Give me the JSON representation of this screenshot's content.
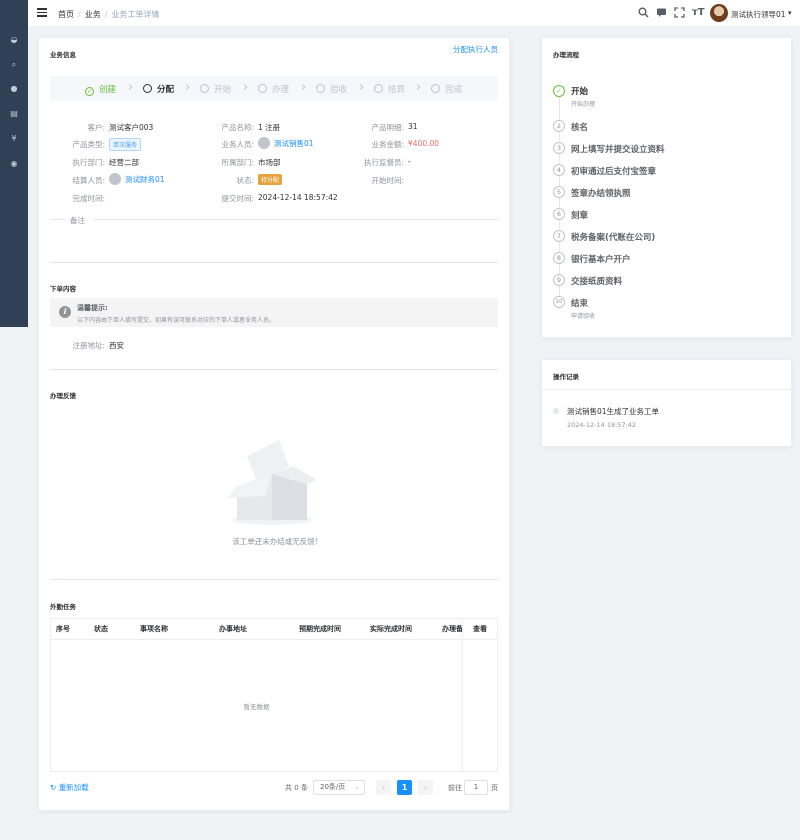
{
  "header": {
    "breadcrumb": [
      "首页",
      "业务",
      "业务工单详情"
    ],
    "user_name": "测试执行领导01"
  },
  "info": {
    "title": "业务信息",
    "assign_link": "分配执行人员",
    "steps": [
      "创建",
      "分配",
      "开始",
      "办理",
      "验收",
      "结算",
      "完成"
    ],
    "fields": {
      "customer_label": "客户:",
      "customer": "测试客户003",
      "product_name_label": "产品名称:",
      "product_name": "1 注册",
      "product_detail_label": "产品明细:",
      "product_detail": "31",
      "product_type_label": "产品类型:",
      "product_type": "单次服务",
      "salesperson_label": "业务人员:",
      "salesperson": "测试销售01",
      "amount_label": "业务金额:",
      "amount": "¥400.00",
      "exec_dept_label": "执行部门:",
      "exec_dept": "经营二部",
      "dept_label": "所属部门:",
      "dept": "市场部",
      "supervisor_label": "执行监督员:",
      "supervisor": "-",
      "settler_label": "结算人员:",
      "settler": "测试财务01",
      "status_label": "状态:",
      "status": "待分配",
      "start_time_label": "开始时间:",
      "start_time": "",
      "finish_time_label": "完成时间:",
      "finish_time": "",
      "submit_time_label": "提交时间:",
      "submit_time": "2024-12-14 18:57:42"
    },
    "remark_label": "备注"
  },
  "order": {
    "title": "下单内容",
    "tip_title": "温馨提示:",
    "tip_text": "以下内容由下单人填写提交，如果有误可联系对应的下单人或者业务人员。",
    "address_label": "注册地址:",
    "address": "西安"
  },
  "feedback": {
    "title": "办理反馈",
    "empty_text": "该工单还未办结或无反馈!"
  },
  "tasks": {
    "title": "外勤任务",
    "columns": [
      "序号",
      "状态",
      "事项名称",
      "办事地址",
      "预期完成时间",
      "实际完成时间",
      "办理备",
      "查看"
    ],
    "empty_text": "暂无数据",
    "reload": "重新加载",
    "total": "共 0 条",
    "page_size": "20条/页",
    "current_page": "1",
    "goto_label": "前往",
    "goto_value": "1",
    "page_unit": "页"
  },
  "flow": {
    "title": "办理流程",
    "items": [
      {
        "num": "✓",
        "title": "开始",
        "sub": "开始办理"
      },
      {
        "num": "2",
        "title": "核名",
        "sub": ""
      },
      {
        "num": "3",
        "title": "网上填写并提交设立资料",
        "sub": ""
      },
      {
        "num": "4",
        "title": "初审通过后支付宝签章",
        "sub": ""
      },
      {
        "num": "5",
        "title": "签章办结领执照",
        "sub": ""
      },
      {
        "num": "6",
        "title": "刻章",
        "sub": ""
      },
      {
        "num": "7",
        "title": "税务备案(代账在公司)",
        "sub": ""
      },
      {
        "num": "8",
        "title": "银行基本户开户",
        "sub": ""
      },
      {
        "num": "9",
        "title": "交接纸质资料",
        "sub": ""
      },
      {
        "num": "10",
        "title": "结束",
        "sub": "申请验收"
      }
    ]
  },
  "log": {
    "title": "操作记录",
    "entry_text": "测试销售01生成了业务工单",
    "entry_time": "2024-12-14 18:57:42"
  },
  "colors": {
    "primary": "#1890ff",
    "success": "#67c23a",
    "danger": "#f56c6c",
    "warning": "#e6a23c",
    "sidebar": "#304156"
  },
  "icons": [
    "menu-icon",
    "search-icon",
    "message-icon",
    "fullscreen-icon",
    "font-size-icon",
    "info-icon",
    "reload-icon"
  ]
}
